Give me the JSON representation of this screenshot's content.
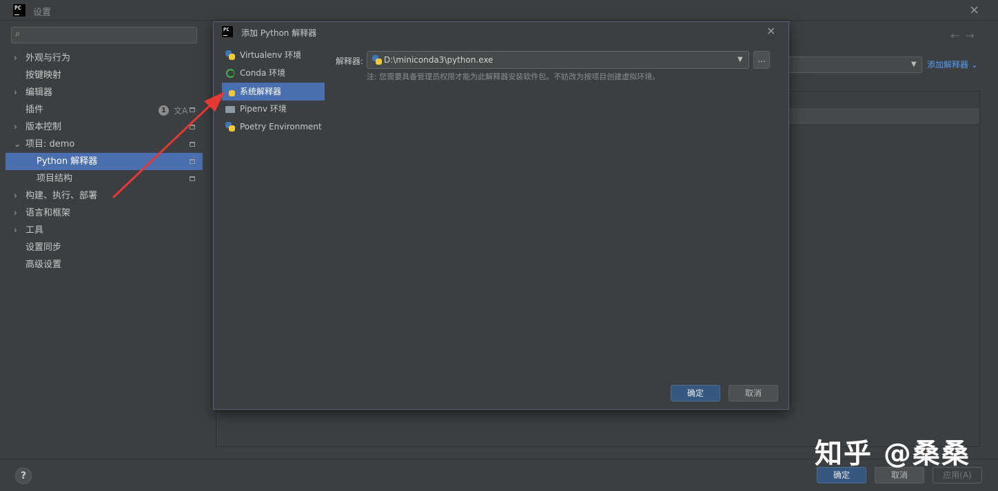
{
  "window": {
    "title": "设置",
    "logo": "PC",
    "close_icon": "×"
  },
  "sidebar": {
    "search_placeholder": "",
    "items": [
      {
        "label": "外观与行为",
        "expandable": true
      },
      {
        "label": "按键映射",
        "expandable": false
      },
      {
        "label": "编辑器",
        "expandable": true
      },
      {
        "label": "插件",
        "expandable": false,
        "badge": "1"
      },
      {
        "label": "版本控制",
        "expandable": true
      },
      {
        "label": "项目: demo",
        "expanded": true
      },
      {
        "label": "Python 解释器",
        "child": true,
        "selected": true
      },
      {
        "label": "项目结构",
        "child": true
      },
      {
        "label": "构建、执行、部署",
        "expandable": true
      },
      {
        "label": "语言和框架",
        "expandable": true
      },
      {
        "label": "工具",
        "expandable": true
      },
      {
        "label": "设置同步",
        "expandable": false
      },
      {
        "label": "高级设置",
        "expandable": false
      }
    ]
  },
  "main": {
    "add_interpreter_label": "添加解释器",
    "back_icon": "←",
    "forward_icon": "→"
  },
  "dialog": {
    "logo": "PC",
    "title": "添加 Python 解释器",
    "close_icon": "×",
    "env_types": [
      {
        "label": "Virtualenv 环境",
        "icon": "python-icon"
      },
      {
        "label": "Conda 环境",
        "icon": "conda-icon"
      },
      {
        "label": "系统解释器",
        "icon": "python-icon",
        "selected": true
      },
      {
        "label": "Pipenv 环境",
        "icon": "pipenv-icon"
      },
      {
        "label": "Poetry Environment",
        "icon": "python-icon"
      }
    ],
    "interpreter_label": "解释器:",
    "interpreter_value": "D:\\miniconda3\\python.exe",
    "browse_label": "...",
    "note": "注: 您需要具备管理员权限才能为此解释器安装软件包。不妨改为按项目创建虚拟环境。",
    "ok_label": "确定",
    "cancel_label": "取消"
  },
  "footer": {
    "help_label": "?",
    "ok_label": "确定",
    "cancel_label": "取消",
    "apply_label": "应用(A)"
  },
  "watermark": "知乎 @桑桑",
  "colors": {
    "background": "#3c3f41",
    "selection": "#4b6eaf",
    "primary_button": "#365880",
    "link": "#589df6",
    "annotation_arrow": "#e53935"
  }
}
